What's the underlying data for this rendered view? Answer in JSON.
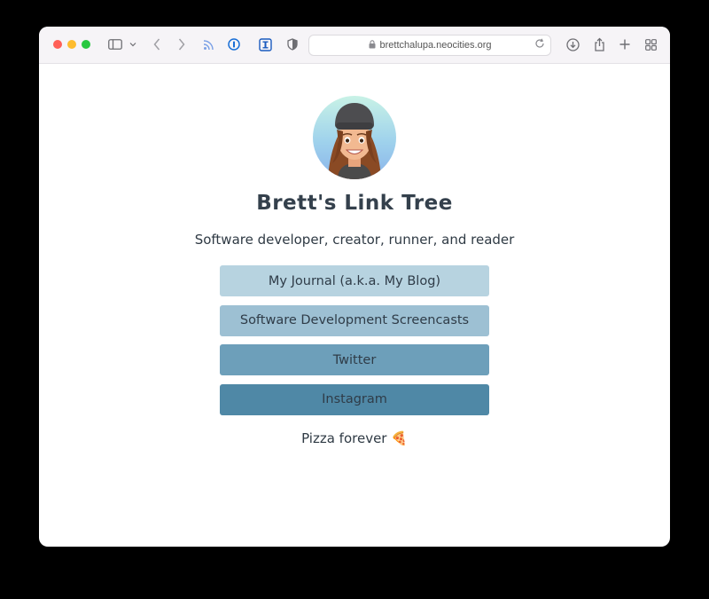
{
  "browser": {
    "url": "brettchalupa.neocities.org"
  },
  "page": {
    "title": "Brett's Link Tree",
    "subtitle": "Software developer, creator, runner, and reader",
    "links": [
      {
        "label": "My Journal (a.k.a. My Blog)",
        "color": "#b7d3e0"
      },
      {
        "label": "Software Development Screencasts",
        "color": "#9dc0d3"
      },
      {
        "label": "Twitter",
        "color": "#6d9fba"
      },
      {
        "label": "Instagram",
        "color": "#4f88a6"
      }
    ],
    "footer": "Pizza forever 🍕"
  }
}
